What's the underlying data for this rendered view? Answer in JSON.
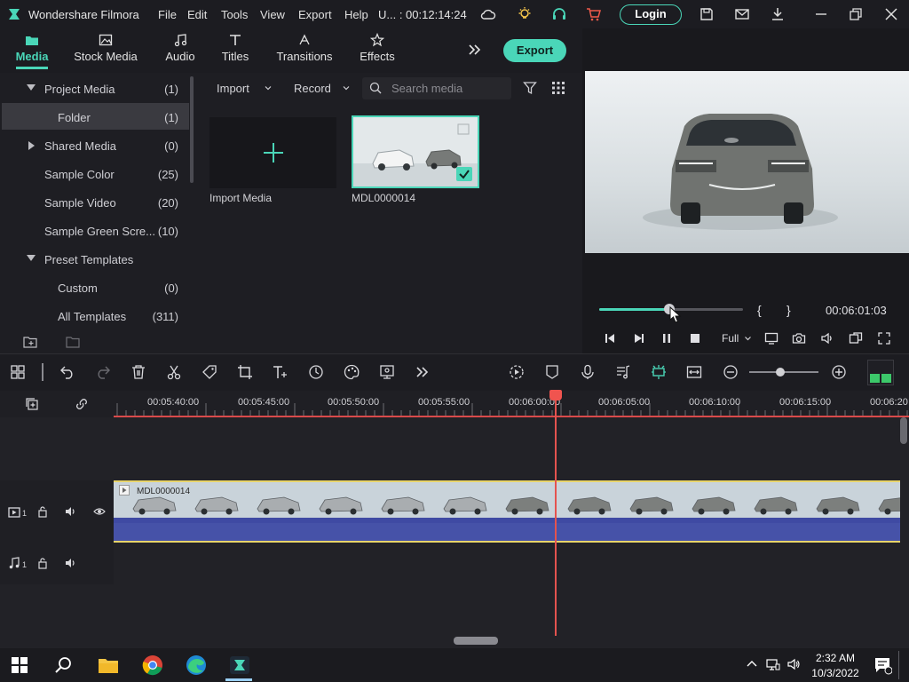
{
  "titlebar": {
    "app_title": "Wondershare Filmora",
    "menu": [
      "File",
      "Edit",
      "Tools",
      "View",
      "Export",
      "Help"
    ],
    "project_time": "U... : 00:12:14:24",
    "login_label": "Login"
  },
  "media_tabs": [
    {
      "label": "Media",
      "icon": "media-icon",
      "active": true
    },
    {
      "label": "Stock Media",
      "icon": "stock-media-icon",
      "active": false
    },
    {
      "label": "Audio",
      "icon": "audio-icon",
      "active": false
    },
    {
      "label": "Titles",
      "icon": "titles-icon",
      "active": false
    },
    {
      "label": "Transitions",
      "icon": "transitions-icon",
      "active": false
    },
    {
      "label": "Effects",
      "icon": "effects-icon",
      "active": false
    }
  ],
  "export_label": "Export",
  "tree": [
    {
      "label": "Project Media",
      "count": "(1)",
      "caret": "down"
    },
    {
      "label": "Folder",
      "count": "(1)",
      "selected": true
    },
    {
      "label": "Shared Media",
      "count": "(0)",
      "caret": "right"
    },
    {
      "label": "Sample Color",
      "count": "(25)"
    },
    {
      "label": "Sample Video",
      "count": "(20)"
    },
    {
      "label": "Sample Green Scre...",
      "count": "(10)"
    },
    {
      "label": "Preset Templates",
      "count": "",
      "caret": "down"
    },
    {
      "label": "Custom",
      "count": "(0)"
    },
    {
      "label": "All Templates",
      "count": "(311)"
    }
  ],
  "media_toolbar": {
    "import_label": "Import",
    "record_label": "Record",
    "search_placeholder": "Search media"
  },
  "media_items": {
    "import_label": "Import Media",
    "clip_label": "MDL0000014"
  },
  "preview": {
    "timecode": "00:06:01:03",
    "progress": 0.49,
    "mark_in": "{",
    "mark_out": "}",
    "quality": "Full"
  },
  "timeline": {
    "ruler_labels": [
      "00:05:40:00",
      "00:05:45:00",
      "00:05:50:00",
      "00:05:55:00",
      "00:06:00:00",
      "00:06:05:00",
      "00:06:10:00",
      "00:06:15:00",
      "00:06:20"
    ],
    "video_track_num": "1",
    "audio_track_num": "1",
    "clip_name": "MDL0000014",
    "zoom_level": 0.45
  },
  "taskbar": {
    "time": "2:32 AM",
    "date": "10/3/2022"
  },
  "colors": {
    "accent": "#4ad6b8",
    "playhead": "#e4534f",
    "clip_border": "#e8d46a"
  }
}
